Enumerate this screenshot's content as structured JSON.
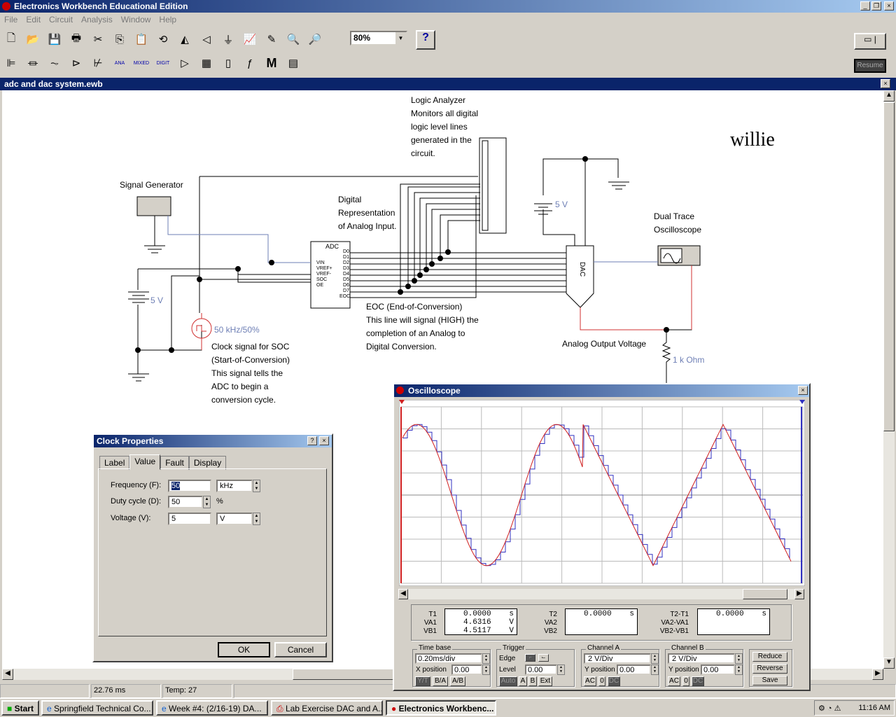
{
  "app": {
    "title": "Electronics Workbench Educational Edition"
  },
  "menu": [
    "File",
    "Edit",
    "Circuit",
    "Analysis",
    "Window",
    "Help"
  ],
  "toolbar": {
    "zoom": "80%",
    "help": "?",
    "resume": "Resume",
    "parts_bins": [
      "ANA",
      "MIXED",
      "DIGIT",
      "M"
    ]
  },
  "document": {
    "title": "adc and dac system.ewb"
  },
  "circuit": {
    "signal_generator": "Signal Generator",
    "logic_analyzer_note": [
      "Logic Analyzer",
      "Monitors all digital",
      "logic level lines",
      "generated in the",
      "circuit."
    ],
    "digital_note": [
      "Digital",
      "Representation",
      "of Analog Input."
    ],
    "author": "willie",
    "battery_left": "5 V",
    "battery_right": "5 V",
    "clock_value": "50 kHz/50%",
    "clock_note": [
      "Clock signal for SOC",
      "(Start-of-Conversion)",
      "This signal tells the",
      "ADC to begin a",
      "conversion cycle."
    ],
    "eoc_note": [
      "EOC (End-of-Conversion)",
      "This line will signal (HIGH) the",
      "completion of an Analog to",
      "Digital Conversion."
    ],
    "oscilloscope_label": [
      "Dual Trace",
      "Oscilloscope"
    ],
    "analog_output": "Analog Output Voltage",
    "resistor": "1 k Ohm",
    "adc": {
      "title": "ADC",
      "inputs": [
        "VIN",
        "VREF+",
        "VREF-",
        "SOC",
        "OE"
      ],
      "outputs": [
        "D0",
        "D1",
        "D2",
        "D3",
        "D4",
        "D5",
        "D6",
        "D7",
        "EOC"
      ]
    },
    "dac": {
      "title": "DAC"
    }
  },
  "clock_dialog": {
    "title": "Clock Properties",
    "help": "?",
    "close": "×",
    "tabs": [
      "Label",
      "Value",
      "Fault",
      "Display"
    ],
    "active_tab": "Value",
    "frequency": {
      "label": "Frequency (F):",
      "value": "50",
      "unit": "kHz"
    },
    "duty": {
      "label": "Duty cycle (D):",
      "value": "50",
      "unit": "%"
    },
    "voltage": {
      "label": "Voltage (V):",
      "value": "5",
      "unit": "V"
    },
    "ok": "OK",
    "cancel": "Cancel"
  },
  "oscilloscope": {
    "title": "Oscilloscope",
    "close": "×",
    "readout": {
      "T1": "0.0000",
      "T1u": "s",
      "VA1": "4.6316",
      "VA1u": "V",
      "VB1": "4.5117",
      "VB1u": "V",
      "T2": "0.0000",
      "T2u": "s",
      "T2T1": "0.0000",
      "T2T1u": "s",
      "labels": {
        "t1": "T1",
        "va1": "VA1",
        "vb1": "VB1",
        "t2": "T2",
        "va2": "VA2",
        "vb2": "VB2",
        "dt": "T2-T1",
        "dva": "VA2-VA1",
        "dvb": "VB2-VB1"
      }
    },
    "timebase": {
      "caption": "Time base",
      "value": "0.20ms/div",
      "xpos_label": "X position",
      "xpos": "0.00",
      "modes": [
        "Y/T",
        "B/A",
        "A/B"
      ],
      "active": "Y/T"
    },
    "trigger": {
      "caption": "Trigger",
      "edge_label": "Edge",
      "level_label": "Level",
      "level": "0.00",
      "sources": [
        "Auto",
        "A",
        "B",
        "Ext"
      ],
      "active": "Auto"
    },
    "channel_a": {
      "caption": "Channel A",
      "scale": "2 V/Div",
      "ypos_label": "Y position",
      "ypos": "0.00",
      "coupling": [
        "AC",
        "0",
        "DC"
      ],
      "active": "DC"
    },
    "channel_b": {
      "caption": "Channel B",
      "scale": "2 V/Div",
      "ypos_label": "Y position",
      "ypos": "0.00",
      "coupling": [
        "AC",
        "0",
        "DC"
      ],
      "active": "DC"
    },
    "buttons": [
      "Reduce",
      "Reverse",
      "Save"
    ],
    "colors": {
      "channel_a": "#d02020",
      "channel_b": "#3030c0"
    }
  },
  "status": {
    "time": "22.76 ms",
    "temp": "Temp:  27"
  },
  "taskbar": {
    "start": "Start",
    "items": [
      "Springfield Technical Co...",
      "Week #4: (2/16-19) DA...",
      "Lab Exercise DAC and A...",
      "Electronics Workbenc..."
    ],
    "clock": "11:16 AM"
  }
}
